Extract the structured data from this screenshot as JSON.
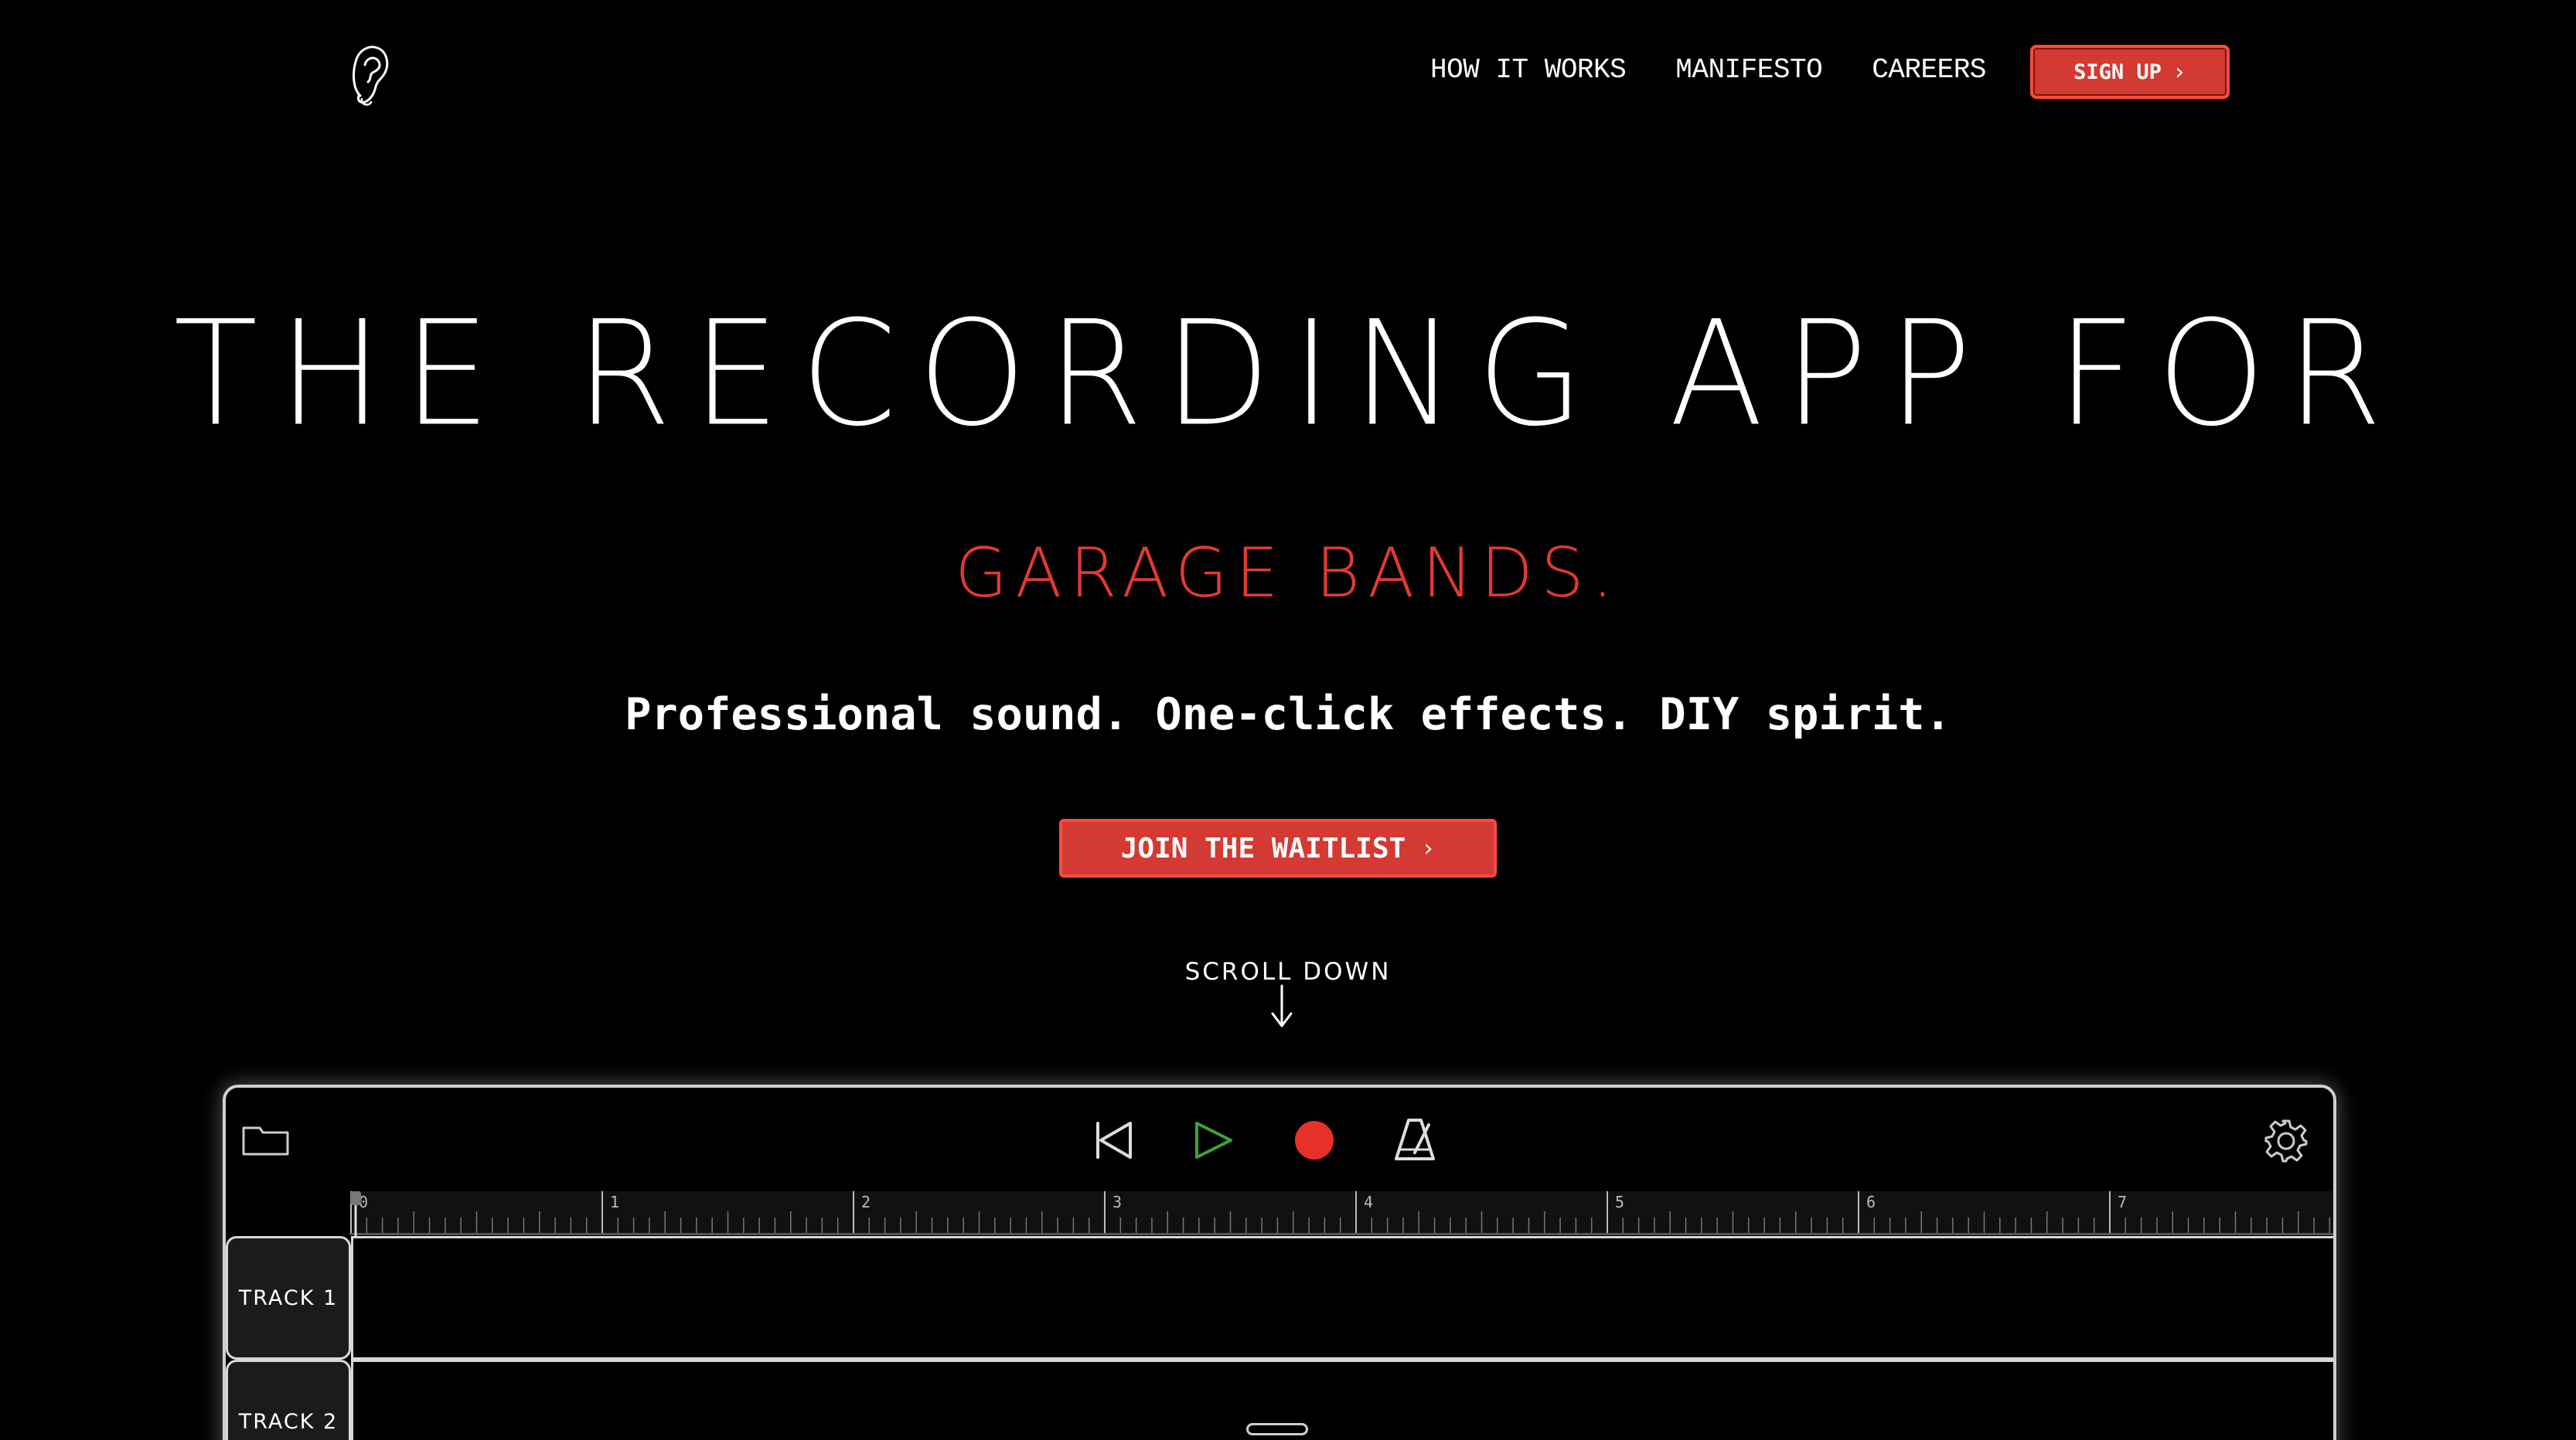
{
  "nav": {
    "links": [
      "HOW IT WORKS",
      "MANIFESTO",
      "CAREERS"
    ],
    "signup_label": "SIGN UP",
    "chevron": "›"
  },
  "hero": {
    "title": "THE RECORDING APP FOR",
    "subtitle": "GARAGE BANDS.",
    "tagline": "Professional sound. One-click effects. DIY spirit.",
    "cta_label": "JOIN THE WAITLIST",
    "cta_chevron": "›",
    "scroll_hint": "SCROLL DOWN"
  },
  "app": {
    "toolbar_icons": [
      "folder-icon",
      "rewind-icon",
      "play-icon",
      "record-icon",
      "metronome-icon",
      "gear-icon"
    ],
    "ruler_labels": [
      "0",
      "1",
      "2",
      "3",
      "4",
      "5",
      "6",
      "7"
    ],
    "tracks": [
      "TRACK 1",
      "TRACK 2"
    ]
  },
  "colors": {
    "background": "#000000",
    "accent_red": "#d33a33",
    "play_green": "#3fa23a",
    "record_red": "#e8302a"
  }
}
